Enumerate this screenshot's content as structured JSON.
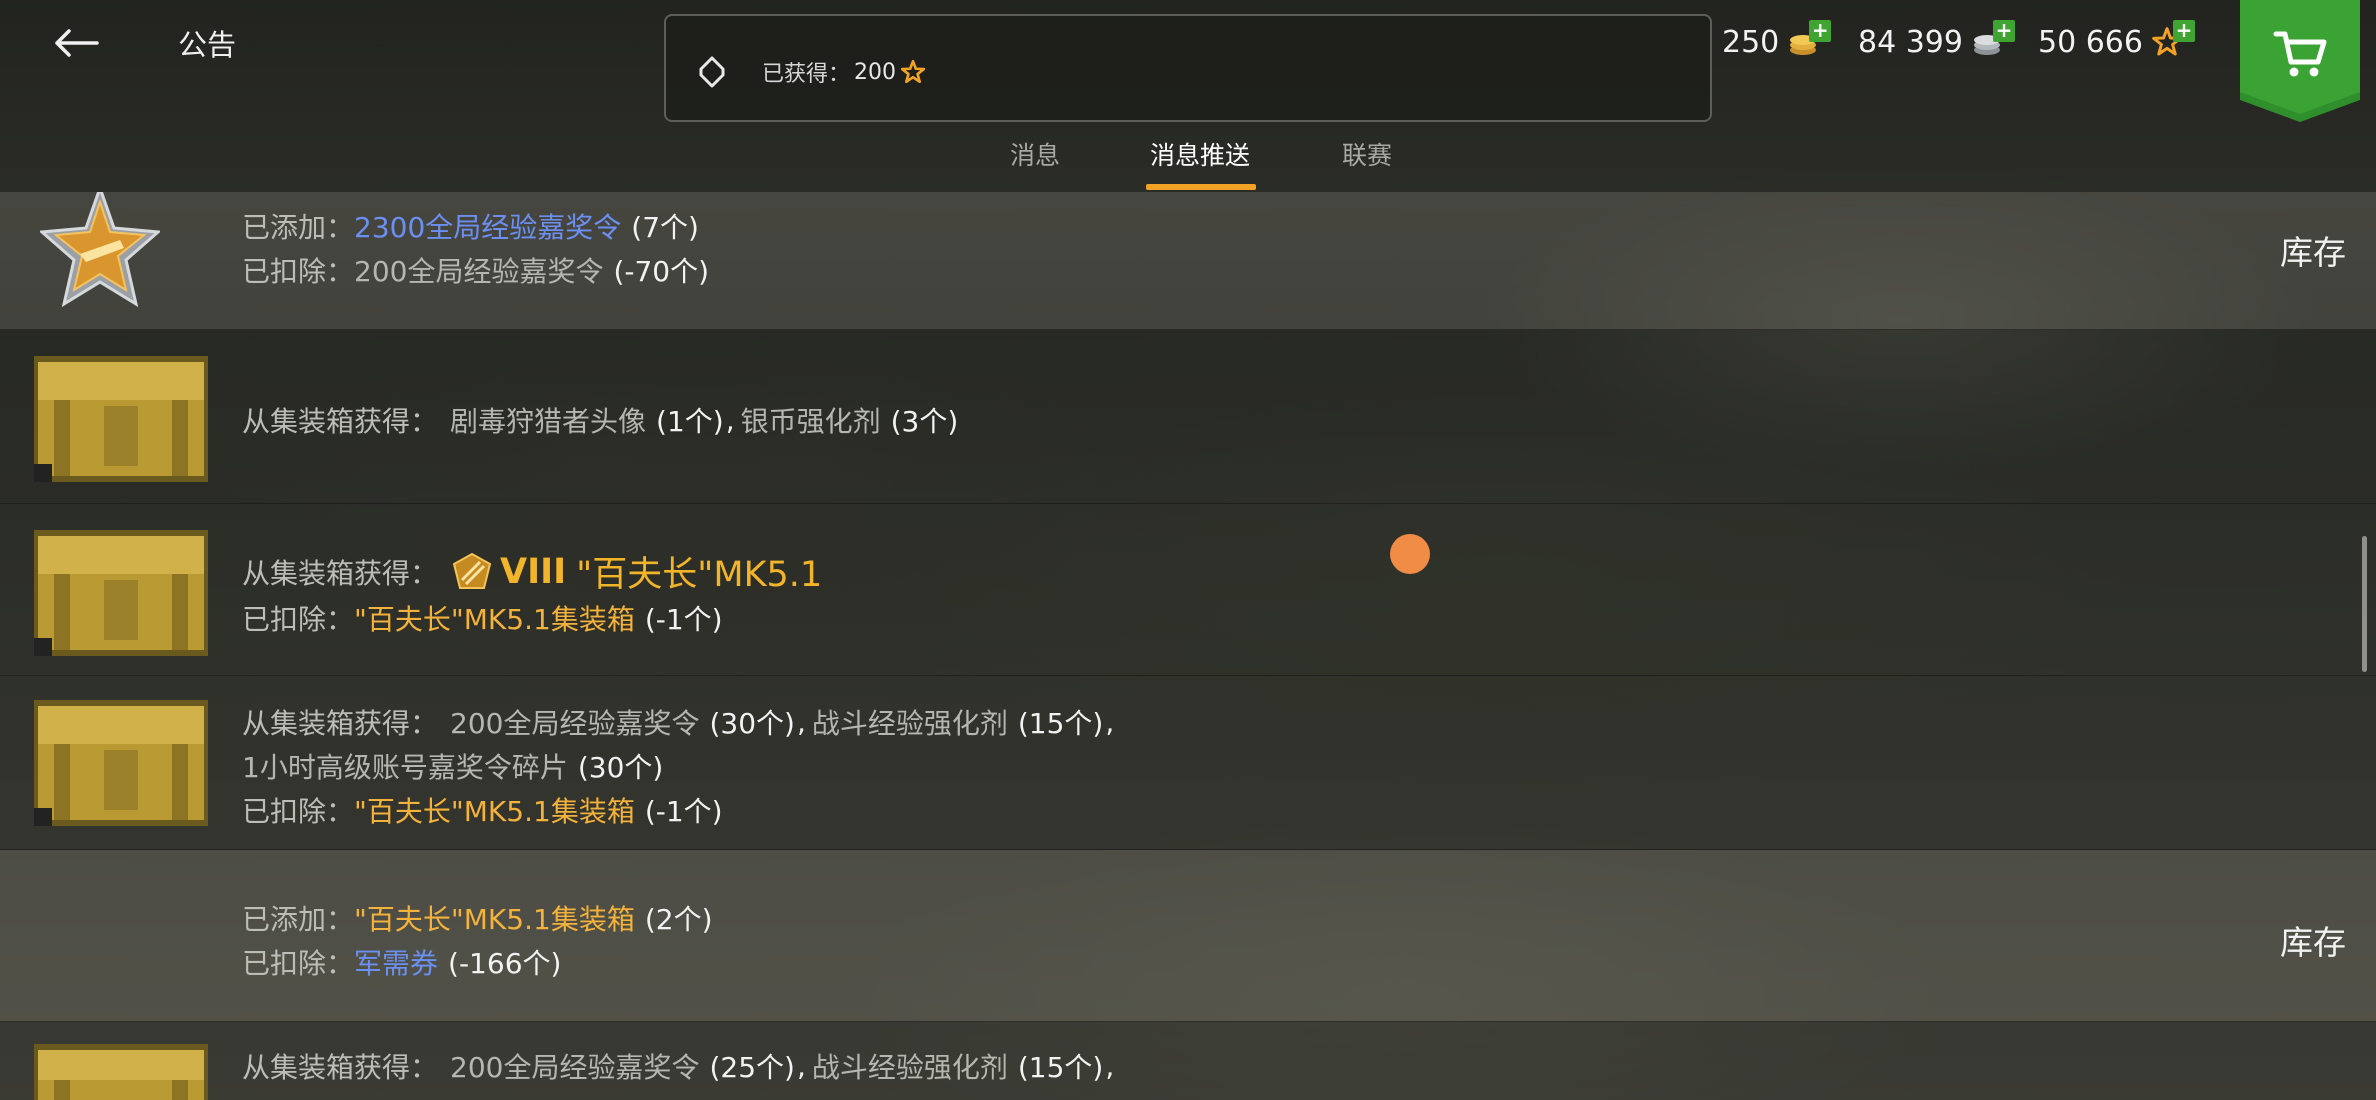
{
  "header": {
    "title": "公告",
    "notice_label": "已获得：",
    "notice_value": "200"
  },
  "currencies": {
    "gold": "250",
    "silver": "84 399",
    "free_xp": "50 666"
  },
  "tabs": [
    {
      "label": "消息"
    },
    {
      "label": "消息推送"
    },
    {
      "label": "联赛"
    }
  ],
  "active_tab": "消息推送",
  "rows": [
    {
      "lines": [
        {
          "label": "已添加：",
          "item": "2300全局经验嘉奖令",
          "count": "(7个)"
        },
        {
          "label": "已扣除：",
          "item": "200全局经验嘉奖令",
          "count": "(-70个)"
        }
      ],
      "action": "库存"
    },
    {
      "line": {
        "label": "从集装箱获得：",
        "item1": "剧毒狩猎者头像",
        "count1": "(1个)",
        "sep": ",",
        "item2": "银币强化剂",
        "count2": "(3个)"
      }
    },
    {
      "line1": {
        "label": "从集装箱获得：",
        "tier": "VIII",
        "tank": "\"百夫长\"MK5.1"
      },
      "line2": {
        "label": "已扣除：",
        "item": "\"百夫长\"MK5.1集装箱",
        "count": "(-1个)"
      }
    },
    {
      "line1": {
        "label": "从集装箱获得：",
        "item1": "200全局经验嘉奖令",
        "count1": "(30个)",
        "sep": ",",
        "item2": "战斗经验强化剂",
        "count2": "(15个)",
        "sep2": ","
      },
      "line2": {
        "item": "1小时高级账号嘉奖令碎片",
        "count": "(30个)"
      },
      "line3": {
        "label": "已扣除：",
        "item": "\"百夫长\"MK5.1集装箱",
        "count": "(-1个)"
      }
    },
    {
      "lines": [
        {
          "label": "已添加：",
          "item": "\"百夫长\"MK5.1集装箱",
          "count": "(2个)"
        },
        {
          "label": "已扣除：",
          "item": "军需券",
          "count": "(-166个)"
        }
      ],
      "action": "库存"
    },
    {
      "line1": {
        "label": "从集装箱获得：",
        "item1": "200全局经验嘉奖令",
        "count1": "(25个)",
        "sep": ",",
        "item2": "战斗经验强化剂",
        "count2": "(15个)",
        "sep2": ","
      }
    }
  ]
}
